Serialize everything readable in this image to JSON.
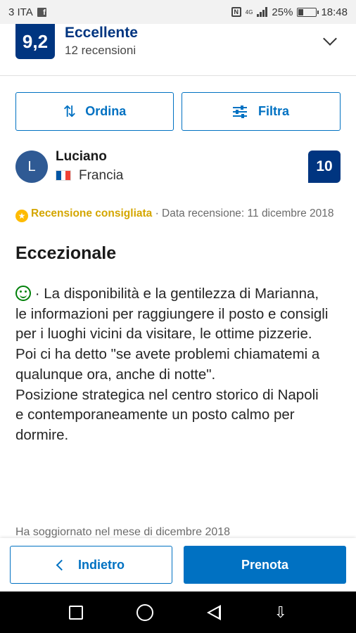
{
  "status_bar": {
    "carrier": "3 ITA",
    "facebook_icon": "facebook-icon",
    "nfc_icon": "N",
    "network_label": "4G",
    "battery": "25%",
    "time": "18:48"
  },
  "score_header": {
    "score": "9,2",
    "word": "Eccellente",
    "reviews_count": "12 recensioni"
  },
  "controls": {
    "sort_label": "Ordina",
    "sort_icon": "⇅",
    "filter_label": "Filtra"
  },
  "review": {
    "avatar_letter": "L",
    "reviewer_name": "Luciano",
    "country": "Francia",
    "flag_colors": [
      "#0055a4",
      "#ffffff",
      "#ef4135"
    ],
    "score": "10",
    "recommended_label": "Recensione consigliata",
    "date_text": " · Data recensione: 11 dicembre 2018",
    "title": "Eccezionale",
    "positive_lines": [
      " · La disponibilità e la gentilezza di Marianna,",
      "le informazioni per raggiungere il posto e consigli per i luoghi vicini da visitare, le ottime pizzerie.",
      "Poi ci ha detto \"se avete problemi chiamatemi a qualunque ora, anche di notte\".",
      "Posizione strategica nel centro storico di Napoli",
      "e contemporaneamente un posto calmo per dormire."
    ],
    "stayed_text": "Ha soggiornato nel mese di dicembre 2018"
  },
  "actions": {
    "back_label": "Indietro",
    "book_label": "Prenota"
  },
  "colors": {
    "brand_dark_blue": "#003580",
    "action_blue": "#0071c2",
    "recommended_yellow": "#febb02",
    "positive_green": "#008009"
  }
}
